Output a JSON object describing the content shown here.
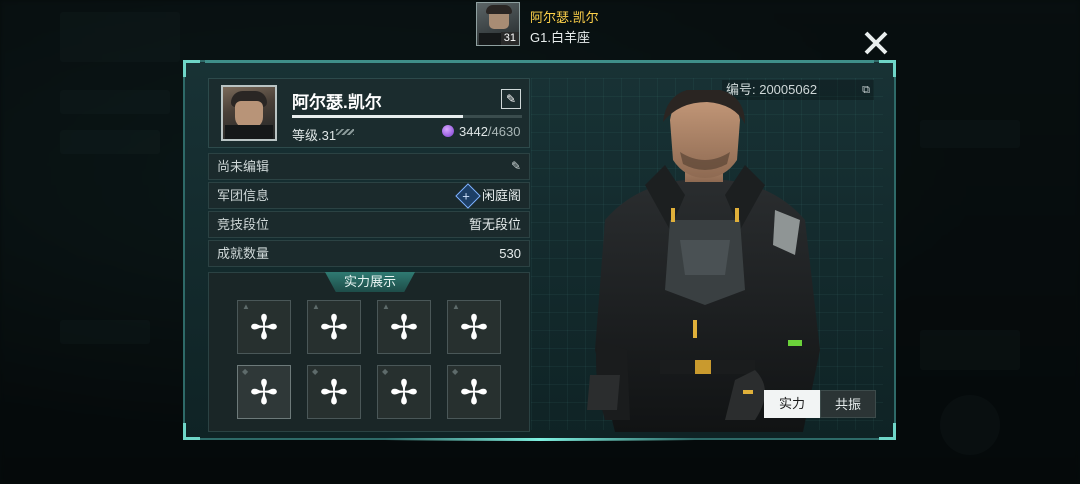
{
  "header": {
    "player_name": "阿尔瑟.凯尔",
    "player_level": "31",
    "rank": "G1.白羊座",
    "close_icon": "close-icon"
  },
  "profile": {
    "name": "阿尔瑟.凯尔",
    "level_text": "等级.31",
    "exp_current": "3442",
    "exp_max": "/4630",
    "exp_progress": 0.743,
    "id_text": "编号: 20005062"
  },
  "info_rows": [
    {
      "key": "尚未编辑",
      "value": ""
    },
    {
      "key": "军团信息",
      "value": "闲庭阁"
    },
    {
      "key": "竞技段位",
      "value": "暂无段位"
    },
    {
      "key": "成就数量",
      "value": "530"
    }
  ],
  "showcase": {
    "title": "实力展示",
    "slot_symbol": "✢"
  },
  "toggle": {
    "strength": "实力",
    "resonance": "共振"
  }
}
